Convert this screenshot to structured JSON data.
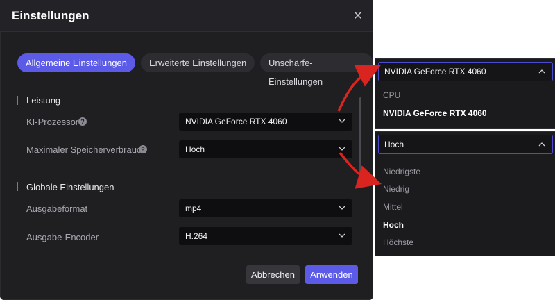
{
  "dialog": {
    "title": "Einstellungen",
    "close_icon": "close-icon",
    "tabs": [
      {
        "label": "Allgemeine Einstellungen",
        "active": true
      },
      {
        "label": "Erweiterte Einstellungen",
        "active": false
      },
      {
        "label": "Unschärfe-Einstellungen",
        "active": false
      }
    ],
    "sections": [
      {
        "title": "Leistung"
      },
      {
        "title": "Globale Einstellungen"
      }
    ],
    "rows": [
      {
        "label": "KI-Prozessor",
        "value": "NVIDIA GeForce RTX 4060",
        "help": "?"
      },
      {
        "label": "Maximaler Speicherverbrauch",
        "value": "Hoch",
        "help": "?"
      },
      {
        "label": "Ausgabeformat",
        "value": "mp4"
      },
      {
        "label": "Ausgabe-Encoder",
        "value": "H.264"
      }
    ],
    "buttons": {
      "cancel": "Abbrechen",
      "apply": "Anwenden"
    }
  },
  "dropdowns": [
    {
      "selected": "NVIDIA GeForce RTX 4060",
      "options": [
        "CPU",
        "NVIDIA GeForce RTX 4060"
      ]
    },
    {
      "selected": "Hoch",
      "options": [
        "Niedrigste",
        "Niedrig",
        "Mittel",
        "Hoch",
        "Höchste"
      ]
    }
  ],
  "colors": {
    "accent": "#5b5be8",
    "arrow": "#d9241f",
    "background": "#1f1f22"
  }
}
